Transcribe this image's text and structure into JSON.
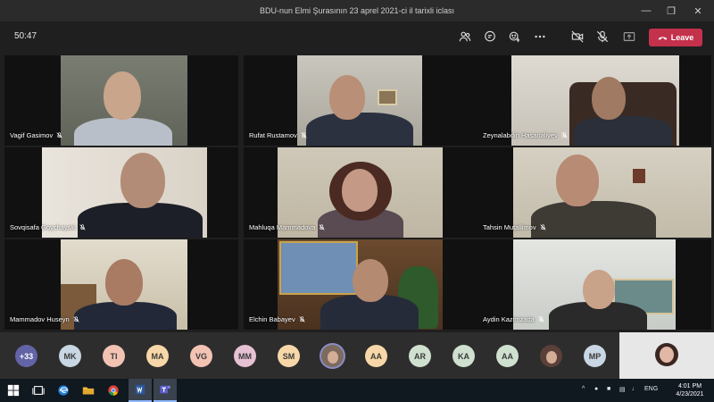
{
  "window": {
    "title": "BDU-nun Elmi Şurasının 23 aprel 2021-ci il tarixli iclası",
    "controls": [
      "minimize-icon",
      "restore-icon",
      "close-icon"
    ]
  },
  "meeting": {
    "timer": "50:47",
    "actions": [
      "people-icon",
      "chat-icon",
      "reactions-icon",
      "more-icon",
      "camera-off-icon",
      "mic-off-icon",
      "share-icon"
    ],
    "leave_label": "Leave"
  },
  "participants": [
    {
      "name": "Vagif Gasimov",
      "muted": true
    },
    {
      "name": "Rufat Rustamov",
      "muted": true
    },
    {
      "name": "Zeynalabdin Hasanaliyev",
      "muted": true
    },
    {
      "name": "Sovqisafa Goychayski",
      "muted": true
    },
    {
      "name": "Mahluqa Mammadova",
      "muted": true
    },
    {
      "name": "Tahsin Mutallimov",
      "muted": true
    },
    {
      "name": "Mammadov Huseyn",
      "muted": true
    },
    {
      "name": "Elchin Babayev",
      "muted": true
    },
    {
      "name": "Aydin Kazimzada",
      "muted": true
    }
  ],
  "roster": {
    "overflow": "+33",
    "avatars": [
      {
        "initials": "MK",
        "color": "#c9d6e3"
      },
      {
        "initials": "TI",
        "color": "#f2c3b3"
      },
      {
        "initials": "MA",
        "color": "#f7d7a8"
      },
      {
        "initials": "VG",
        "color": "#f2c3b3"
      },
      {
        "initials": "MM",
        "color": "#e6c1d3"
      },
      {
        "initials": "SM",
        "color": "#f7d7a8"
      },
      {
        "initials": "",
        "color": "#7c6b5e",
        "photo": true
      },
      {
        "initials": "AA",
        "color": "#f7d7a8"
      },
      {
        "initials": "AR",
        "color": "#cfe0cf"
      },
      {
        "initials": "KA",
        "color": "#cfe0cf"
      },
      {
        "initials": "AA",
        "color": "#cfe0cf"
      },
      {
        "initials": "",
        "color": "#5a4038",
        "photo": true
      },
      {
        "initials": "MP",
        "color": "#c9d6e3"
      }
    ],
    "overflow_color": "#6264a7"
  },
  "taskbar": {
    "apps": [
      "windows-start-icon",
      "search-icon",
      "task-view-icon",
      "edge-icon",
      "file-explorer-icon",
      "chrome-icon",
      "word-icon",
      "teams-icon"
    ],
    "language": "ENG",
    "time": "4:01 PM",
    "date": "4/23/2021"
  }
}
